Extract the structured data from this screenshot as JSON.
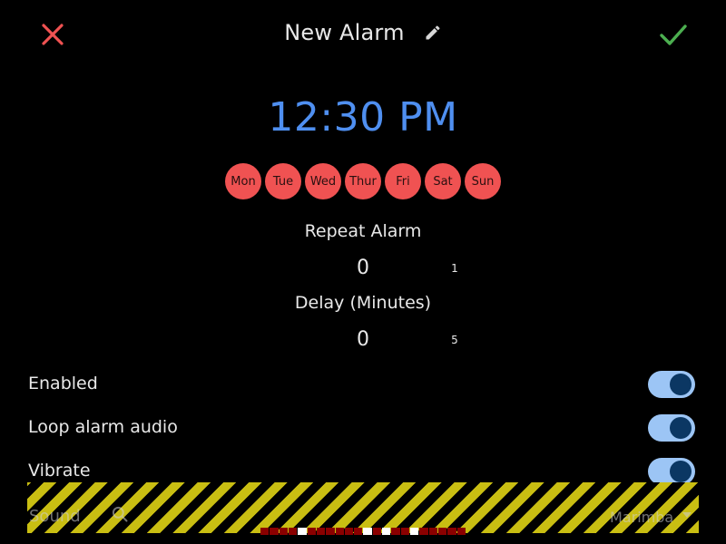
{
  "header": {
    "title": "New Alarm",
    "close_icon": "close-icon",
    "edit_icon": "pencil-icon",
    "confirm_icon": "check-icon"
  },
  "time": "12:30 PM",
  "days": [
    "Mon",
    "Tue",
    "Wed",
    "Thur",
    "Fri",
    "Sat",
    "Sun"
  ],
  "repeat": {
    "label": "Repeat Alarm",
    "value": "0",
    "hint": "1"
  },
  "delay": {
    "label": "Delay (Minutes)",
    "value": "0",
    "hint": "5"
  },
  "toggles": [
    {
      "label": "Enabled",
      "on": true
    },
    {
      "label": "Loop alarm audio",
      "on": true
    },
    {
      "label": "Vibrate",
      "on": true
    }
  ],
  "sound": {
    "label": "Sound",
    "value": "Marimba",
    "search_icon": "search-icon",
    "dropdown_icon": "dropdown-arrow-icon"
  },
  "colors": {
    "background": "#000000",
    "accent_blue": "#4f8ff0",
    "day_red": "#f05252",
    "close_red": "#f05252",
    "confirm_green": "#4caf50",
    "toggle_track": "#9cc5f5",
    "toggle_knob": "#0b3763",
    "warning_yellow": "#c9be12"
  }
}
